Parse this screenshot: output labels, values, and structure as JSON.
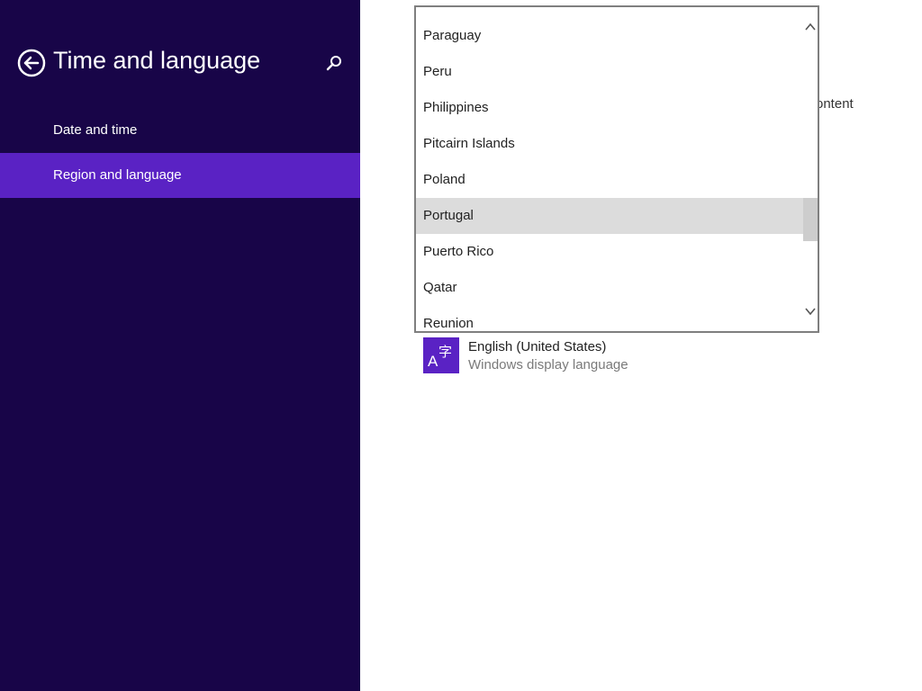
{
  "sidebar": {
    "title": "Time and language",
    "items": [
      {
        "label": "Date and time"
      },
      {
        "label": "Region and language"
      }
    ]
  },
  "content": {
    "partial_text": "ontent",
    "language": {
      "name": "English (United States)",
      "subtitle": "Windows display language"
    }
  },
  "dropdown": {
    "options": [
      {
        "label": "Paraguay"
      },
      {
        "label": "Peru"
      },
      {
        "label": "Philippines"
      },
      {
        "label": "Pitcairn Islands"
      },
      {
        "label": "Poland"
      },
      {
        "label": "Portugal"
      },
      {
        "label": "Puerto Rico"
      },
      {
        "label": "Qatar"
      },
      {
        "label": "Reunion"
      }
    ],
    "highlighted": "Portugal"
  },
  "colors": {
    "sidebar_bg": "#180548",
    "accent": "#5a22c4",
    "highlight": "#dcdcdc"
  },
  "icons": {
    "back": "back-arrow-circle-icon",
    "search": "search-icon",
    "language": "language-icon",
    "scroll_up": "chevron-up-icon",
    "scroll_down": "chevron-down-icon"
  }
}
